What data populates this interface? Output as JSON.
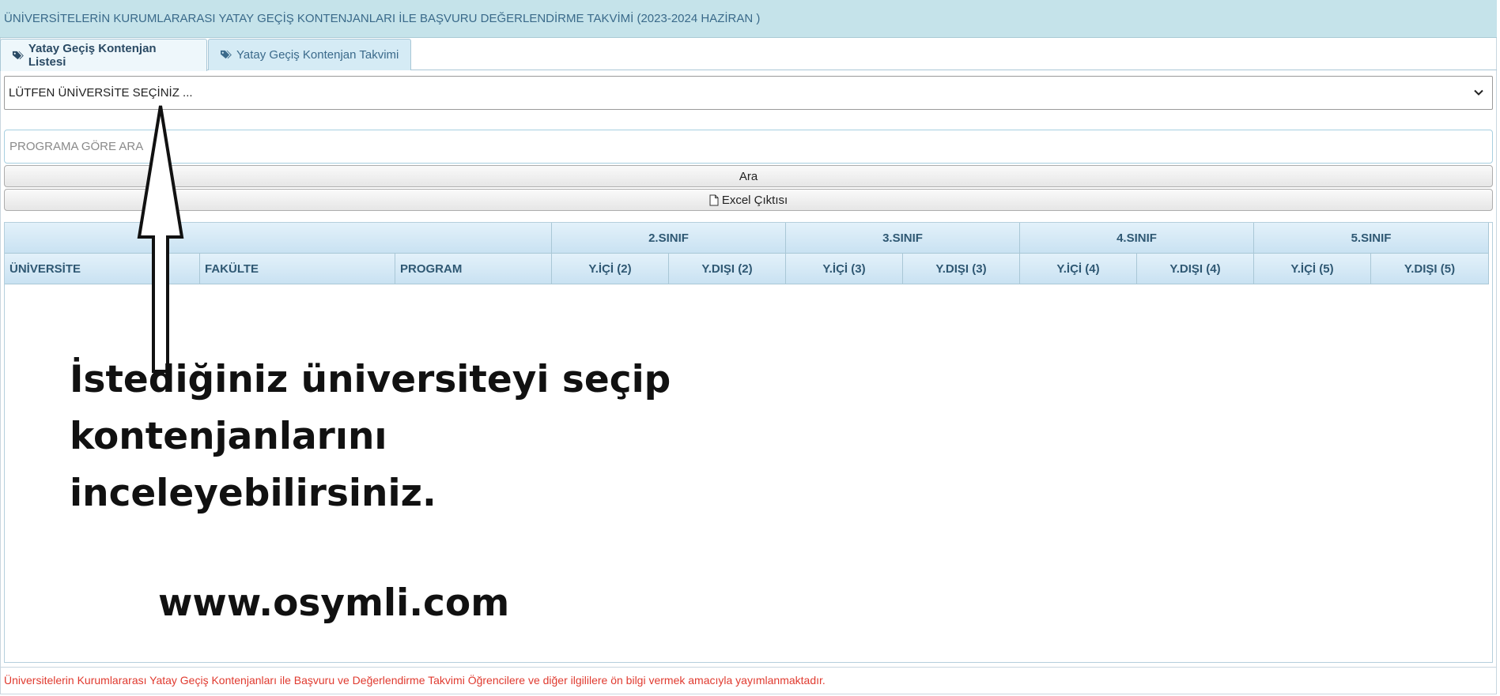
{
  "header": {
    "title": "ÜNİVERSİTELERİN KURUMLARARASI YATAY GEÇİŞ KONTENJANLARI İLE BAŞVURU DEĞERLENDİRME TAKVİMİ (2023-2024 HAZİRAN )"
  },
  "tabs": [
    {
      "label": "Yatay Geçiş Kontenjan Listesi",
      "icon": "tags-icon",
      "active": true
    },
    {
      "label": "Yatay Geçiş Kontenjan Takvimi",
      "icon": "tags-icon",
      "active": false
    }
  ],
  "university_select": {
    "selected": "LÜTFEN ÜNİVERSİTE SEÇİNİZ ..."
  },
  "program_search": {
    "placeholder": "PROGRAMA GÖRE ARA",
    "value": ""
  },
  "buttons": {
    "search_label": "Ara",
    "excel_label": "Excel Çıktısı"
  },
  "table": {
    "group_headers": [
      "2.SINIF",
      "3.SINIF",
      "4.SINIF",
      "5.SINIF"
    ],
    "columns": [
      "ÜNİVERSİTE",
      "FAKÜLTE",
      "PROGRAM",
      "Y.İÇİ (2)",
      "Y.DIŞI (2)",
      "Y.İÇİ (3)",
      "Y.DIŞI (3)",
      "Y.İÇİ (4)",
      "Y.DIŞI (4)",
      "Y.İÇİ (5)",
      "Y.DIŞI (5)"
    ],
    "rows": []
  },
  "overlay": {
    "instruction_line1": "İstediğiniz üniversiteyi seçip kontenjanlarını",
    "instruction_line2": "inceleyebilirsiniz.",
    "website": "www.osymli.com"
  },
  "footer": {
    "note": "Üniversitelerin Kurumlararası Yatay Geçiş Kontenjanları ile Başvuru ve Değerlendirme Takvimi Öğrencilere ve diğer ilgililere ön bilgi vermek amacıyla yayımlanmaktadır."
  },
  "colors": {
    "header_bg": "#c5e3ea",
    "table_header_bg": "#c9e2f2",
    "footer_text": "#e03a2f"
  }
}
